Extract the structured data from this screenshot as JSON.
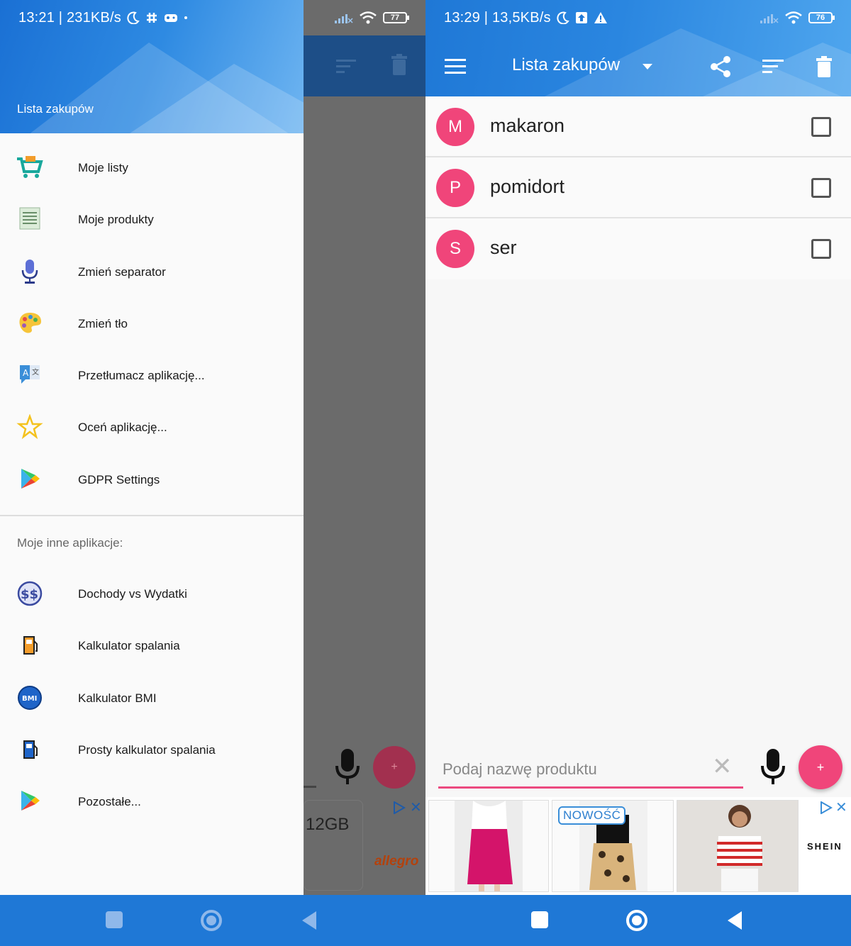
{
  "left": {
    "status": {
      "text": "13:21 | 231KB/s",
      "battery": "77"
    },
    "drawer": {
      "title": "Lista zakupów",
      "menu": [
        {
          "label": "Moje listy",
          "icon": "cart-icon"
        },
        {
          "label": "Moje produkty",
          "icon": "list-icon"
        },
        {
          "label": "Zmień separator",
          "icon": "microphone-icon"
        },
        {
          "label": "Zmień tło",
          "icon": "palette-icon"
        },
        {
          "label": "Przetłumacz aplikację...",
          "icon": "translate-icon"
        },
        {
          "label": "Oceń aplikację...",
          "icon": "star-icon"
        },
        {
          "label": "GDPR Settings",
          "icon": "play-store-icon"
        }
      ],
      "other_apps_header": "Moje inne aplikacje:",
      "other_apps": [
        {
          "label": "Dochody vs Wydatki",
          "icon": "dollar-icon"
        },
        {
          "label": "Kalkulator spalania",
          "icon": "fuel-pump-icon"
        },
        {
          "label": "Kalkulator BMI",
          "icon": "bmi-icon"
        },
        {
          "label": "Prosty kalkulator spalania",
          "icon": "fuel-pump-dark-icon"
        },
        {
          "label": "Pozostałe...",
          "icon": "play-store-icon"
        }
      ]
    },
    "background_ad": {
      "text": "12GB",
      "brand": "allegro"
    }
  },
  "right": {
    "status": {
      "text": "13:29 | 13,5KB/s",
      "battery": "76"
    },
    "appbar": {
      "title": "Lista zakupów"
    },
    "items": [
      {
        "initial": "M",
        "name": "makaron",
        "checked": false
      },
      {
        "initial": "P",
        "name": "pomidort",
        "checked": false
      },
      {
        "initial": "S",
        "name": "ser",
        "checked": false
      }
    ],
    "input": {
      "placeholder": "Podaj nazwę produktu",
      "value": ""
    },
    "fab_label": "+",
    "ad": {
      "badge": "NOWOŚĆ",
      "brand": "SHEIN"
    }
  },
  "colors": {
    "primary": "#1f78d6",
    "accent": "#f0457a"
  }
}
